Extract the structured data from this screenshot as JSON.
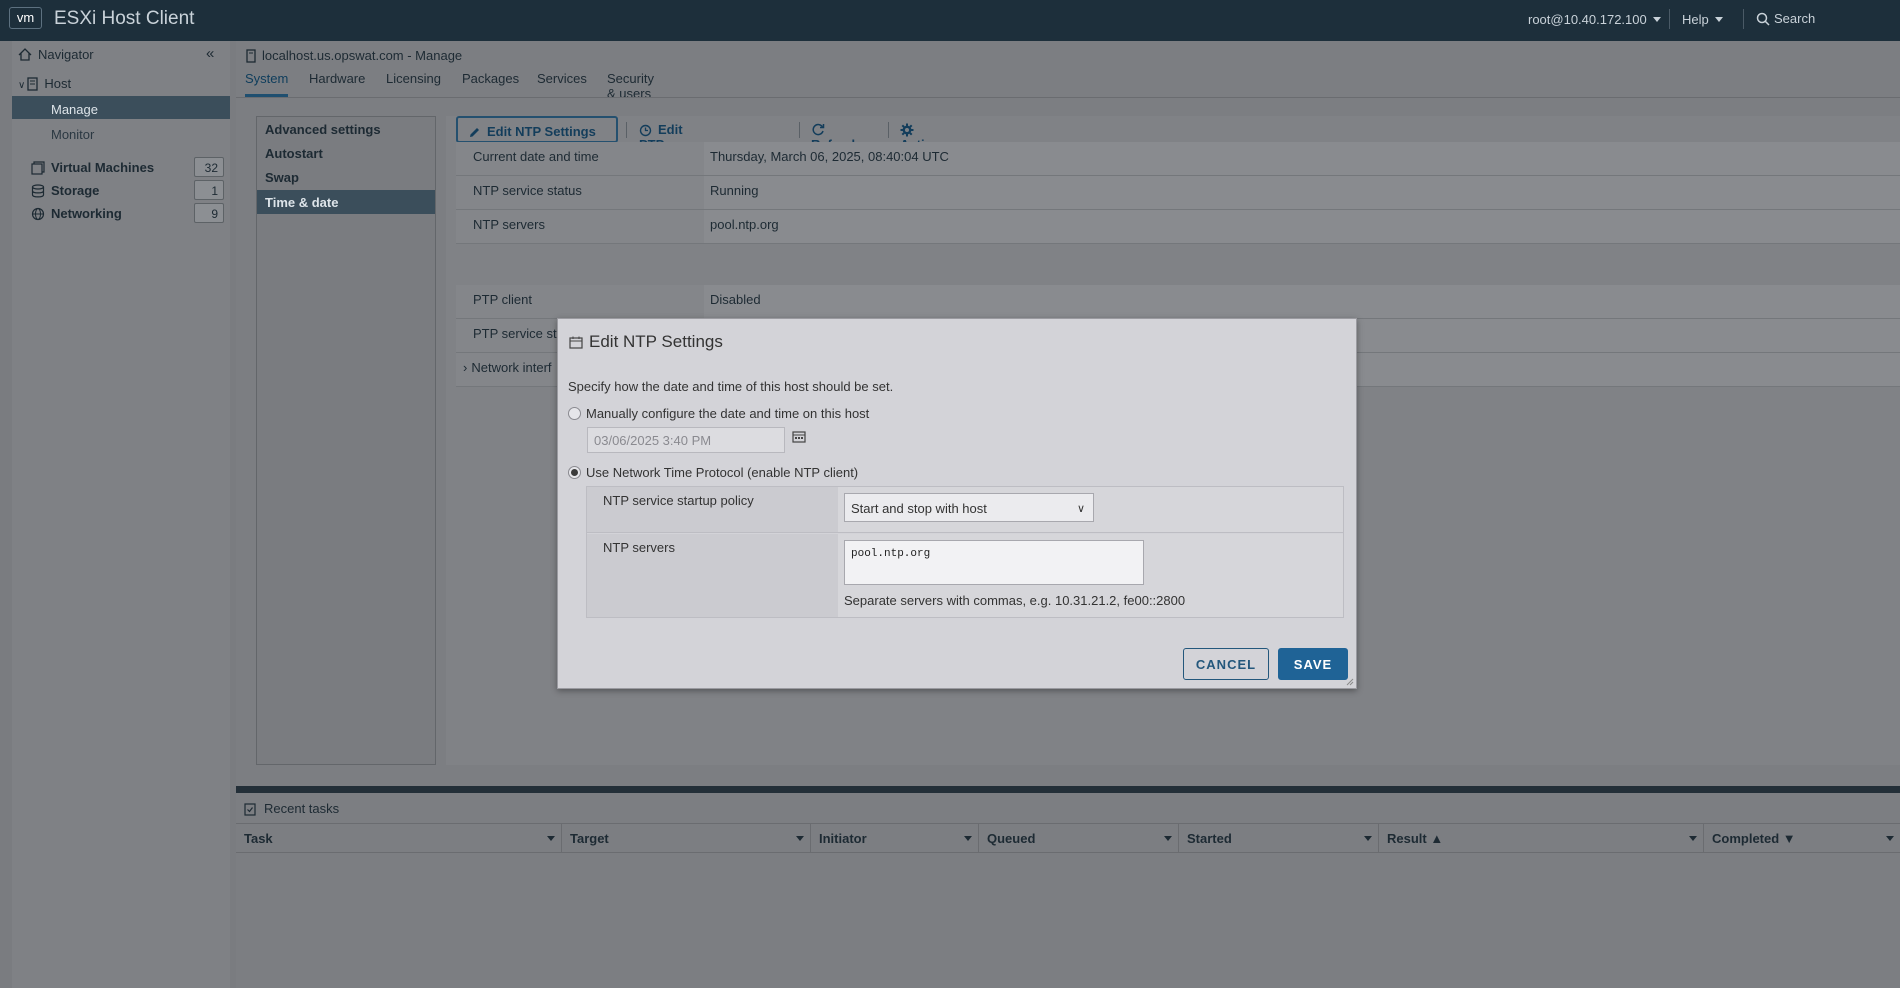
{
  "topbar": {
    "logo": "vm",
    "app_title": "ESXi Host Client",
    "user": "root@10.40.172.100",
    "help": "Help",
    "search": "Search"
  },
  "navigator": {
    "title": "Navigator",
    "host": "Host",
    "host_children": [
      "Manage",
      "Monitor"
    ],
    "items": [
      {
        "label": "Virtual Machines",
        "count": "32"
      },
      {
        "label": "Storage",
        "count": "1"
      },
      {
        "label": "Networking",
        "count": "9"
      }
    ]
  },
  "main": {
    "title": "localhost.us.opswat.com - Manage",
    "tabs": [
      "System",
      "Hardware",
      "Licensing",
      "Packages",
      "Services",
      "Security & users"
    ],
    "side_items": [
      "Advanced settings",
      "Autostart",
      "Swap",
      "Time & date"
    ],
    "toolbar": {
      "edit_ntp": "Edit NTP Settings",
      "edit_ptp": "Edit PTP Settings",
      "refresh": "Refresh",
      "actions": "Actions"
    },
    "props": [
      {
        "label": "Current date and time",
        "value": "Thursday, March 06, 2025, 08:40:04 UTC"
      },
      {
        "label": "NTP service status",
        "value": "Running"
      },
      {
        "label": "NTP servers",
        "value": "pool.ntp.org"
      }
    ],
    "ptp_props": [
      {
        "label": "PTP client",
        "value": "Disabled"
      },
      {
        "label": "PTP service sta",
        "value": ""
      },
      {
        "label": "Network interf",
        "value": ""
      }
    ]
  },
  "tasks": {
    "title": "Recent tasks",
    "columns": [
      "Task",
      "Target",
      "Initiator",
      "Queued",
      "Started",
      "Result ▲",
      "Completed ▼"
    ]
  },
  "dialog": {
    "title": "Edit NTP Settings",
    "description": "Specify how the date and time of this host should be set.",
    "manual_label": "Manually configure the date and time on this host",
    "manual_value": "03/06/2025 3:40 PM",
    "ntp_label": "Use Network Time Protocol (enable NTP client)",
    "startup_policy_label": "NTP service startup policy",
    "startup_policy_value": "Start and stop with host",
    "servers_label": "NTP servers",
    "servers_value": "pool.ntp.org",
    "servers_hint": "Separate servers with commas, e.g. 10.31.21.2, fe00::2800",
    "cancel": "CANCEL",
    "save": "SAVE"
  }
}
